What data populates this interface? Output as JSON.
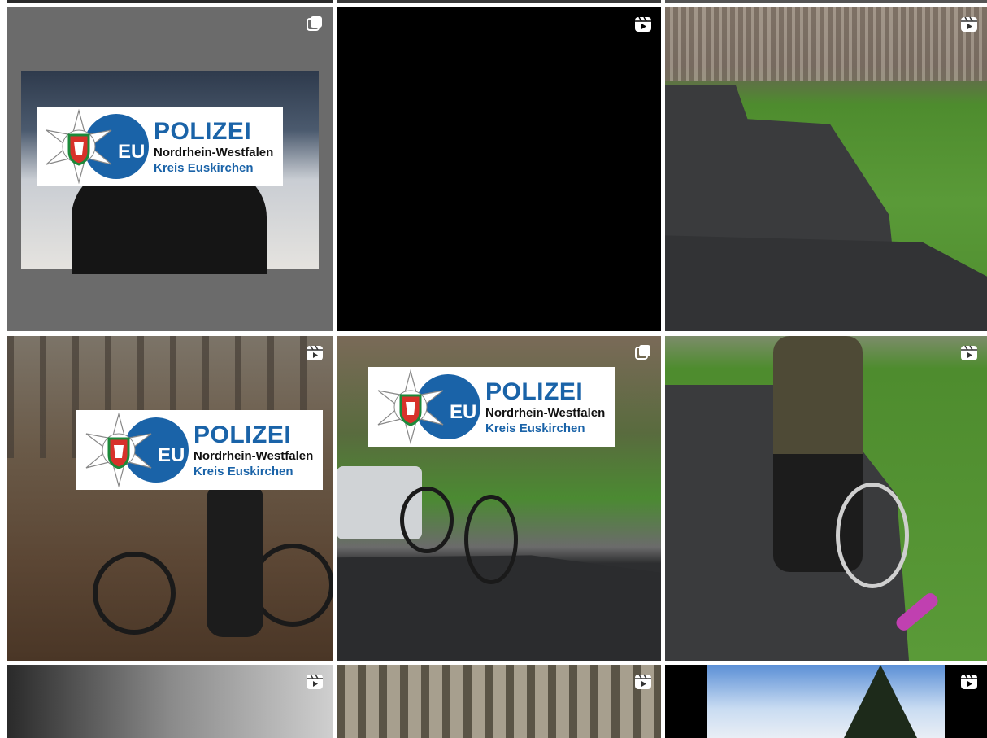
{
  "logo": {
    "title": "POLIZEI",
    "line1": "Nordrhein-Westfalen",
    "line2": "Kreis Euskirchen",
    "badge": "EU"
  },
  "icons": {
    "reel": "reel-icon",
    "carousel": "carousel-icon"
  },
  "colors": {
    "police_blue": "#1a63a8",
    "grass": "#4e8c2e",
    "asphalt": "#3a3b3d"
  },
  "posts": [
    {
      "badge": "none"
    },
    {
      "badge": "none"
    },
    {
      "badge": "none"
    },
    {
      "badge": "carousel-icon"
    },
    {
      "badge": "reel-icon"
    },
    {
      "badge": "reel-icon"
    },
    {
      "badge": "reel-icon"
    },
    {
      "badge": "carousel-icon"
    },
    {
      "badge": "reel-icon"
    },
    {
      "badge": "reel-icon"
    },
    {
      "badge": "reel-icon"
    },
    {
      "badge": "reel-icon"
    }
  ]
}
